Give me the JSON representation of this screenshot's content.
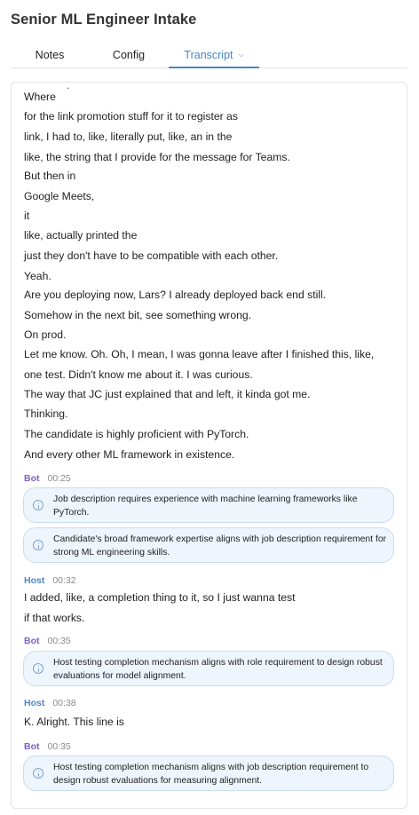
{
  "page": {
    "title": "Senior ML Engineer Intake"
  },
  "tabs": [
    {
      "label": "Notes"
    },
    {
      "label": "Config"
    },
    {
      "label": "Transcript",
      "active": true
    }
  ],
  "transcript": {
    "lines_a": [
      "Where",
      "for the link promotion stuff for it to register as",
      "link, I had to, like, literally put, like, an in the",
      "like, the string that I provide for the message for Teams.",
      "But then in",
      "Google Meets,",
      "it",
      "like, actually printed the",
      "just they don't have to be compatible with each other.",
      "Yeah.",
      "Are you deploying now, Lars? I already deployed back end still.",
      "Somehow in the next bit, see something wrong.",
      "On prod.",
      "Let me know. Oh. Oh, I mean, I was gonna leave after I finished this, like,",
      "one test. Didn't know me about it. I was curious.",
      "The way that JC just explained that and left, it kinda got me.",
      "Thinking.",
      "The candidate is highly proficient with PyTorch.",
      "And every other ML framework in existence."
    ],
    "block1": {
      "speaker": "Bot",
      "time": "00:25",
      "notes": [
        "Job description requires experience with machine learning frameworks like PyTorch.",
        "Candidate's broad framework expertise aligns with job description requirement for strong ML engineering skills."
      ]
    },
    "block2": {
      "speaker": "Host",
      "time": "00:32",
      "lines": [
        "I added, like, a completion thing to it, so I just wanna test",
        "if that works."
      ]
    },
    "block3": {
      "speaker": "Bot",
      "time": "00:35",
      "notes": [
        "Host testing completion mechanism aligns with role requirement to design robust evaluations for model alignment."
      ]
    },
    "block4": {
      "speaker": "Host",
      "time": "00:38",
      "lines": [
        "K. Alright. This line is"
      ]
    },
    "block5": {
      "speaker": "Bot",
      "time": "00:35",
      "notes": [
        "Host testing completion mechanism aligns with job description requirement to design robust evaluations for measuring alignment."
      ]
    }
  }
}
